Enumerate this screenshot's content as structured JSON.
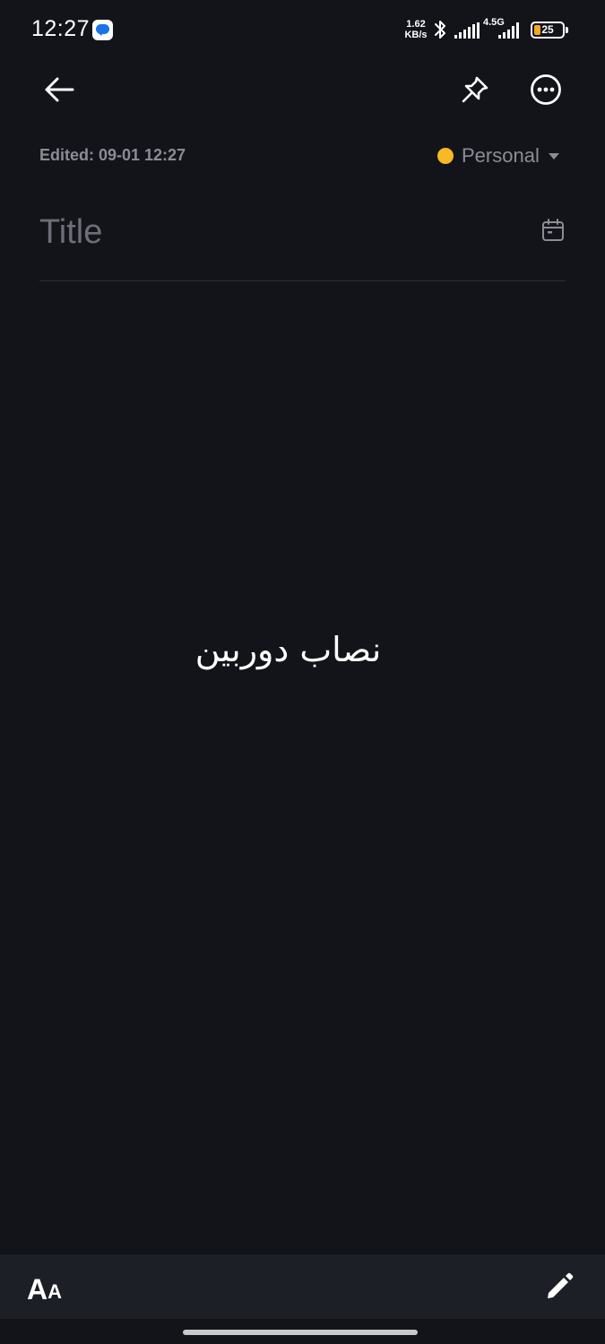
{
  "status_bar": {
    "time": "12:27",
    "net_speed_value": "1.62",
    "net_speed_unit": "KB/s",
    "network_type": "4.5G",
    "battery_level": "25",
    "icons": [
      "messages-icon",
      "bluetooth-icon",
      "signal-icon",
      "battery-icon"
    ]
  },
  "toolbar": {
    "back_icon": "arrow-left-icon",
    "pin_icon": "pin-icon",
    "more_icon": "more-horizontal-circle-icon"
  },
  "meta": {
    "edited": "Edited: 09-01 12:27",
    "category_label": "Personal",
    "category_color": "#f7b924"
  },
  "title": {
    "placeholder": "Title",
    "value": ""
  },
  "note": {
    "body": "نصاب دوربین"
  },
  "bottom_bar": {
    "font_large": "A",
    "font_small": "A",
    "edit_icon": "pencil-icon"
  }
}
